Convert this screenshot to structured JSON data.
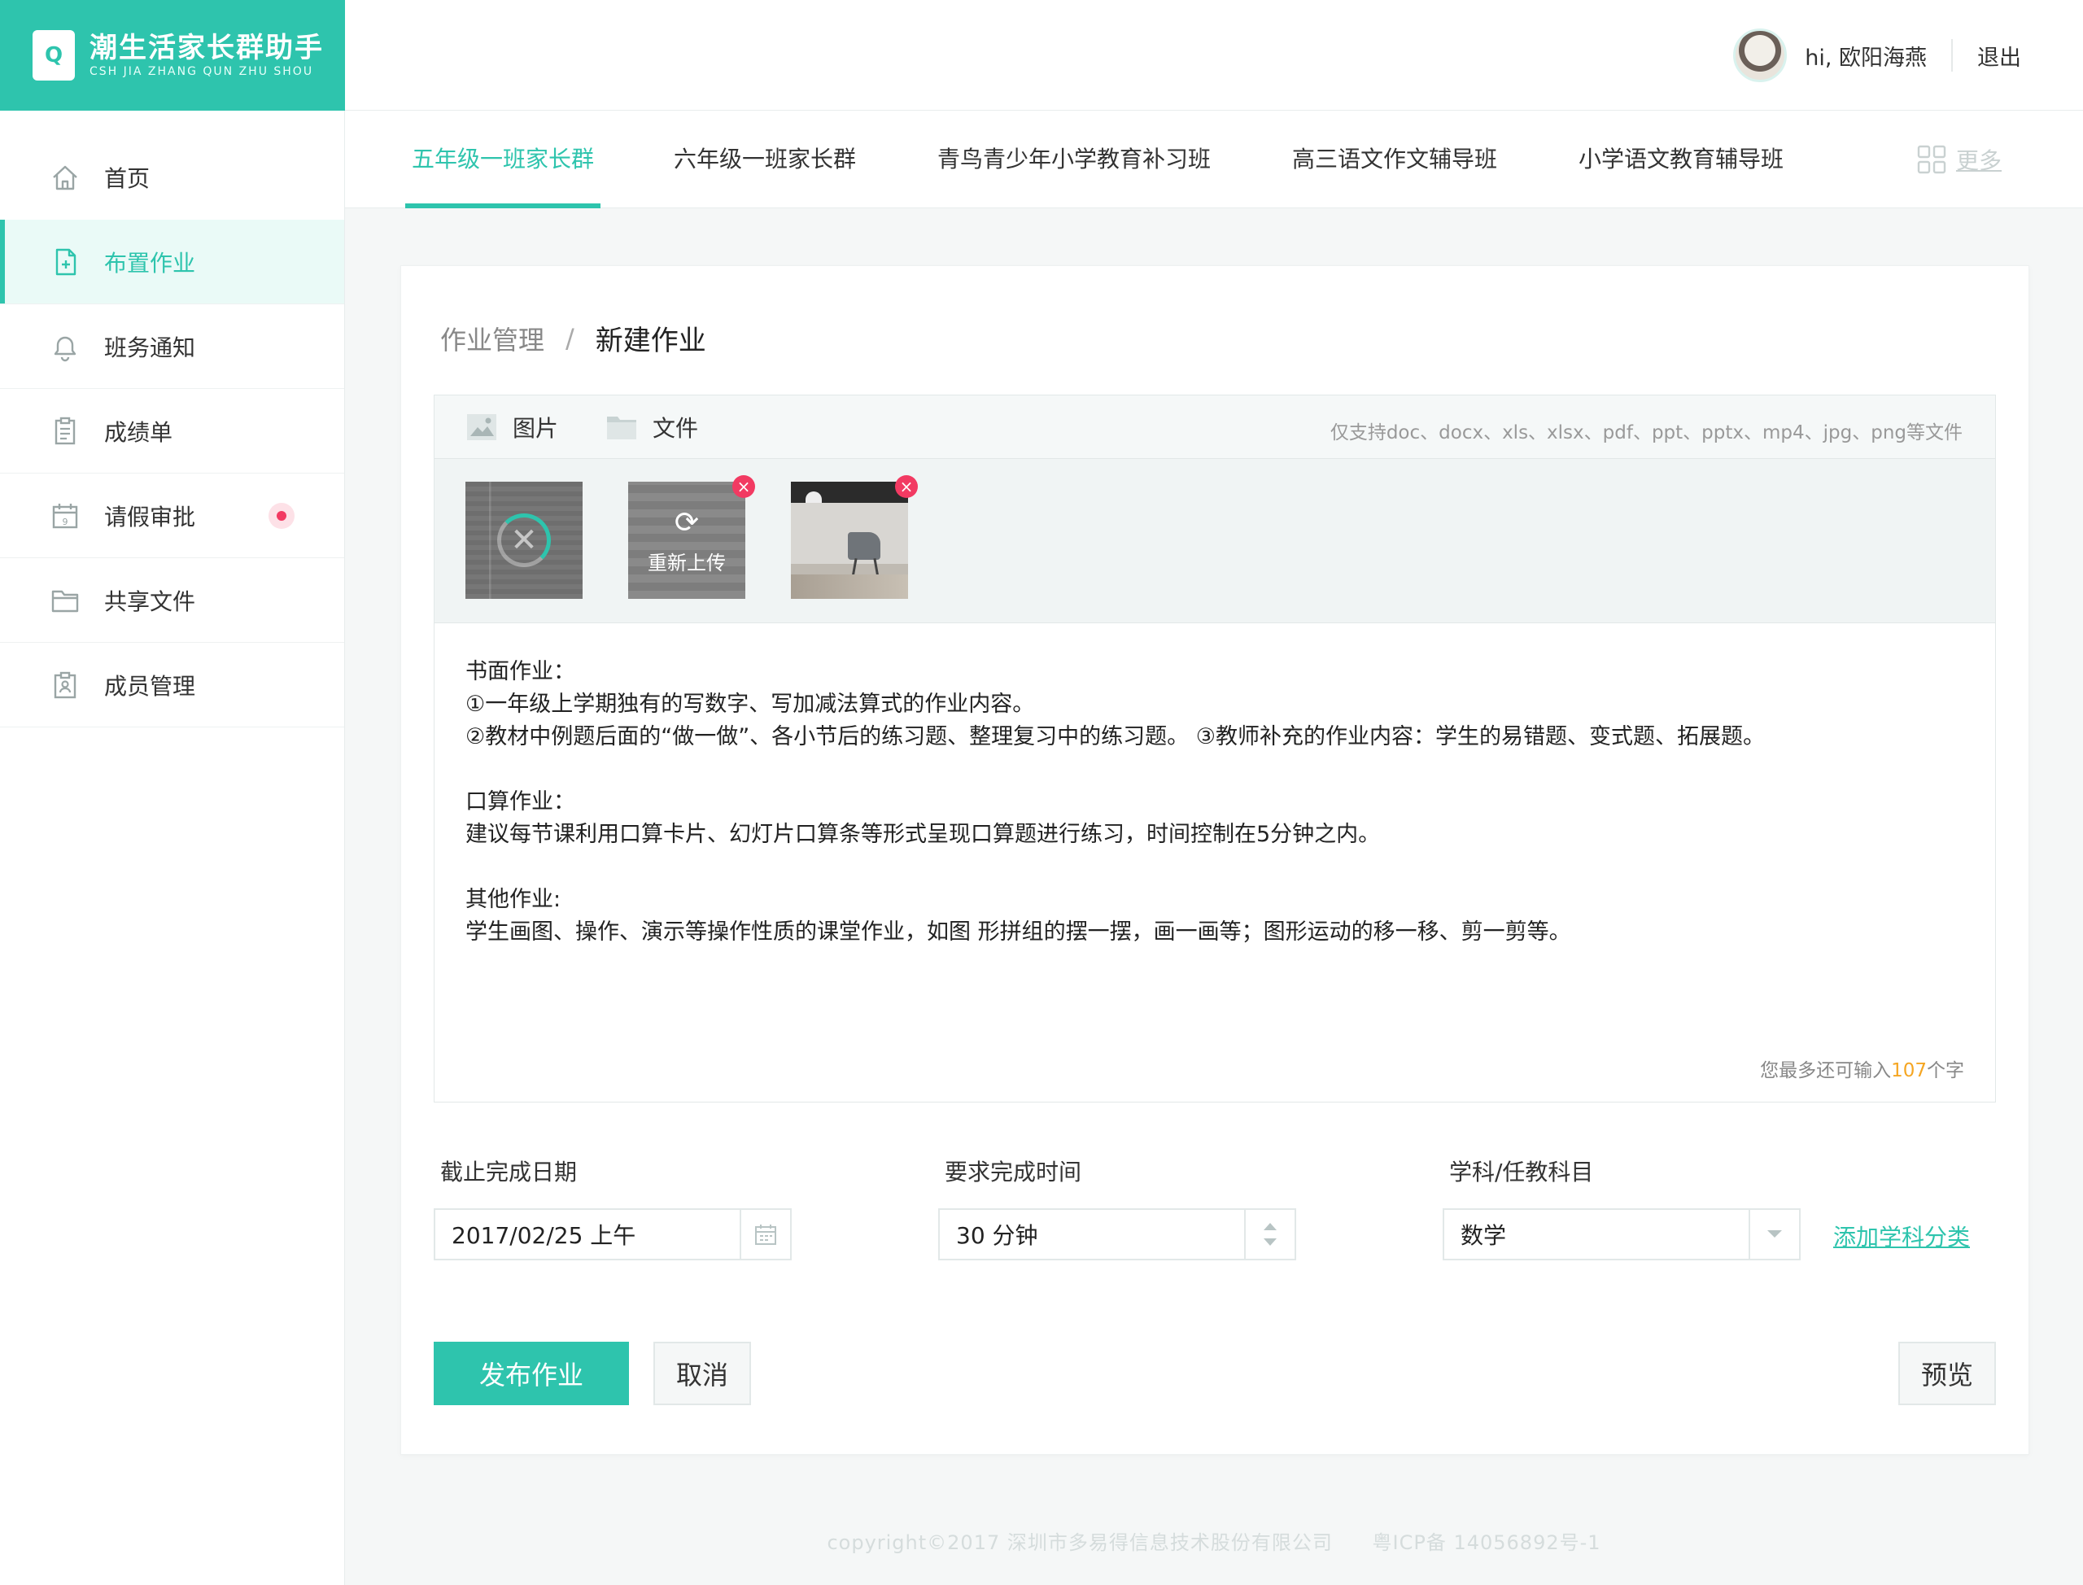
{
  "brand": {
    "logo_letter": "Q",
    "name": "潮生活家长群助手",
    "subtitle": "CSH JIA ZHANG QUN ZHU SHOU",
    "accent_color": "#2ec4ad"
  },
  "header": {
    "greeting": "hi, 欧阳海燕",
    "logout": "退出"
  },
  "sidebar": {
    "items": [
      {
        "label": "首页",
        "icon": "home-icon"
      },
      {
        "label": "布置作业",
        "icon": "assignment-icon",
        "active": true
      },
      {
        "label": "班务通知",
        "icon": "bell-icon"
      },
      {
        "label": "成绩单",
        "icon": "report-icon"
      },
      {
        "label": "请假审批",
        "icon": "calendar-icon",
        "badge": true
      },
      {
        "label": "共享文件",
        "icon": "folder-icon"
      },
      {
        "label": "成员管理",
        "icon": "members-icon"
      }
    ]
  },
  "tabs": {
    "items": [
      {
        "label": "五年级一班家长群",
        "active": true
      },
      {
        "label": "六年级一班家长群"
      },
      {
        "label": "青鸟青少年小学教育补习班"
      },
      {
        "label": "高三语文作文辅导班"
      },
      {
        "label": "小学语文教育辅导班"
      }
    ],
    "more": "更多"
  },
  "breadcrumb": {
    "parent": "作业管理",
    "separator": "/",
    "current": "新建作业"
  },
  "editor": {
    "toolbar": {
      "image": "图片",
      "file": "文件",
      "support_note": "仅支持doc、docx、xls、xlsx、pdf、ppt、pptx、mp4、jpg、png等文件"
    },
    "attachments": {
      "reupload": "重新上传",
      "delete_symbol": "×"
    },
    "content": "书面作业：\n①一年级上学期独有的写数字、写加减法算式的作业内容。\n②教材中例题后面的“做一做”、各小节后的练习题、整理复习中的练习题。 ③教师补充的作业内容：学生的易错题、变式题、拓展题。\n\n口算作业：\n建议每节课利用口算卡片、幻灯片口算条等形式呈现口算题进行练习，时间控制在5分钟之内。\n\n其他作业:\n学生画图、操作、演示等操作性质的课堂作业，如图 形拼组的摆一摆，画一画等；图形运动的移一移、剪一剪等。",
    "char_count_prefix": "您最多还可输入",
    "char_count_value": "107",
    "char_count_suffix": "个字"
  },
  "form": {
    "deadline_label": "截止完成日期",
    "deadline_value": "2017/02/25 上午",
    "duration_label": "要求完成时间",
    "duration_value": "30 分钟",
    "subject_label": "学科/任教科目",
    "subject_value": "数学",
    "add_subject": "添加学科分类"
  },
  "actions": {
    "publish": "发布作业",
    "cancel": "取消",
    "preview": "预览"
  },
  "footer": {
    "copyright": "copyright©2017  深圳市多易得信息技术股份有限公司",
    "icp": "粤ICP备  14056892号-1"
  }
}
